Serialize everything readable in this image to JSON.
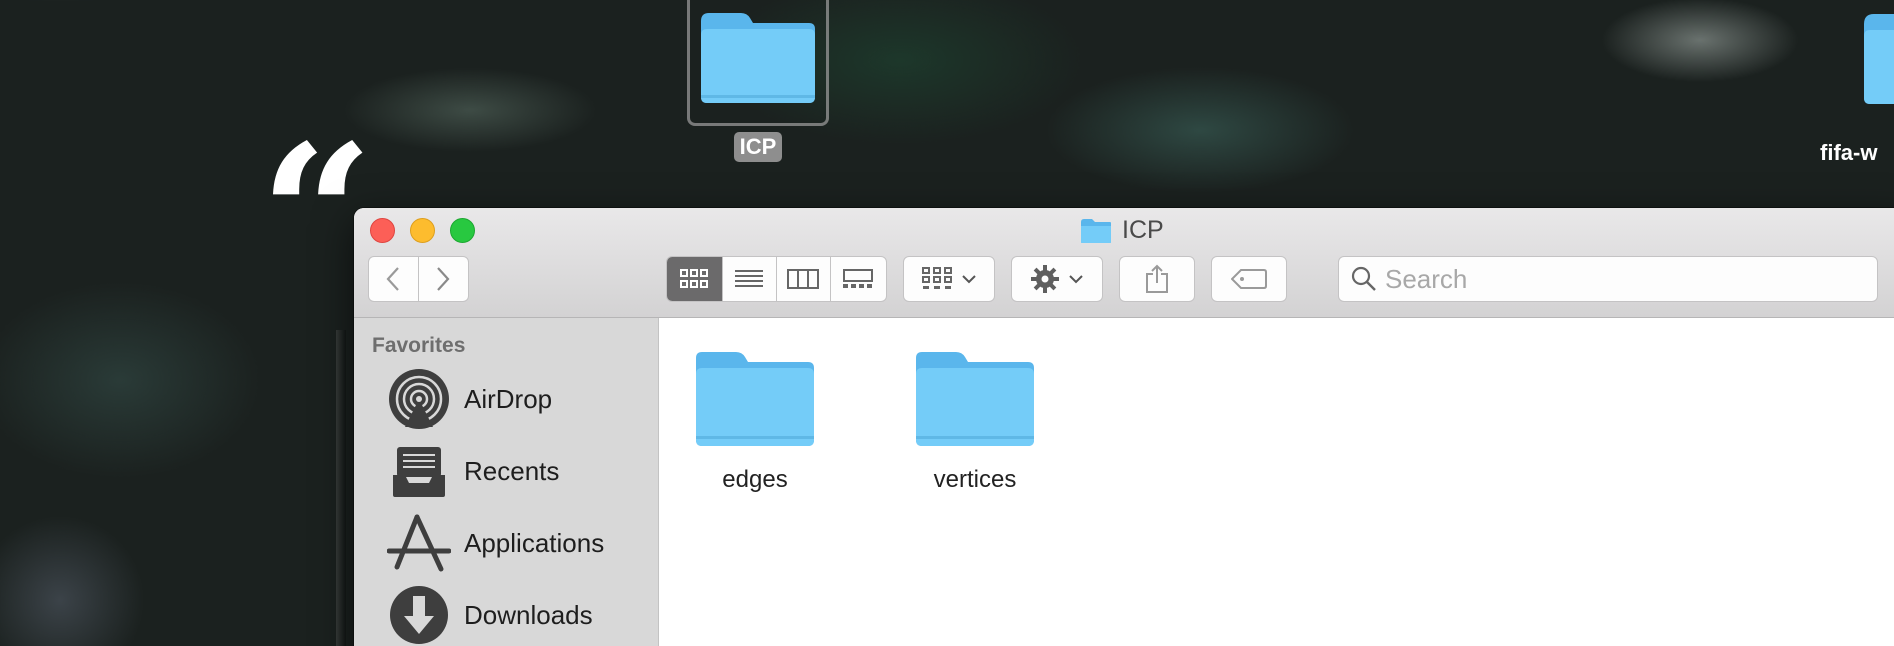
{
  "desktop": {
    "items": [
      {
        "label": "ICP",
        "selected": true
      },
      {
        "label": "fifa-w"
      }
    ]
  },
  "window": {
    "title": "ICP",
    "toolbar": {
      "back_icon": "chevron-left-icon",
      "forward_icon": "chevron-right-icon",
      "view_modes": [
        "icon-view",
        "list-view",
        "column-view",
        "gallery-view"
      ],
      "active_view": "icon-view",
      "search_placeholder": "Search"
    },
    "sidebar": {
      "section_title": "Favorites",
      "items": [
        {
          "label": "AirDrop",
          "icon": "airdrop-icon"
        },
        {
          "label": "Recents",
          "icon": "recents-icon"
        },
        {
          "label": "Applications",
          "icon": "applications-icon"
        },
        {
          "label": "Downloads",
          "icon": "downloads-icon"
        }
      ]
    },
    "files": [
      {
        "name": "edges",
        "icon": "folder-icon"
      },
      {
        "name": "vertices",
        "icon": "folder-icon"
      }
    ]
  },
  "colors": {
    "folder": "#6cc3f4",
    "close": "#fc5f57",
    "minimize": "#fdbc2e",
    "zoom": "#28c840"
  }
}
